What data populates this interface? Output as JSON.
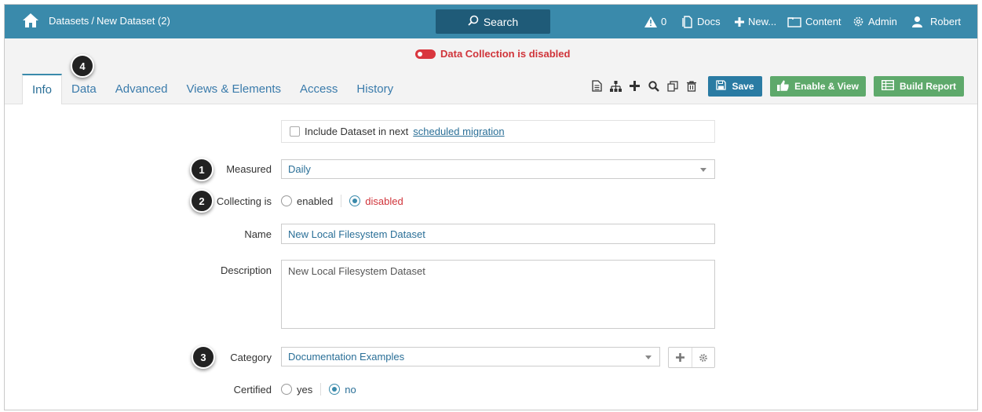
{
  "header": {
    "breadcrumb_root": "Datasets",
    "breadcrumb_sep": "/",
    "breadcrumb_current": "New Dataset (2)",
    "search_label": "Search",
    "alerts_count": "0",
    "docs_label": "Docs",
    "new_label": "New...",
    "content_label": "Content",
    "admin_label": "Admin",
    "user_label": "Robert"
  },
  "status": {
    "data_collection": "Data Collection is disabled",
    "color": "#d0343a"
  },
  "tabs": [
    {
      "label": "Info",
      "active": true
    },
    {
      "label": "Data"
    },
    {
      "label": "Advanced"
    },
    {
      "label": "Views & Elements"
    },
    {
      "label": "Access"
    },
    {
      "label": "History"
    }
  ],
  "toolbar": {
    "icons": [
      "document-icon",
      "hierarchy-icon",
      "plus-icon",
      "search-icon",
      "copy-icon",
      "trash-icon"
    ],
    "save_label": "Save",
    "enable_view_label": "Enable & View",
    "build_report_label": "Build Report"
  },
  "callouts": [
    "1",
    "2",
    "3",
    "4"
  ],
  "form": {
    "migration": {
      "text": "Include Dataset in next",
      "link": "scheduled migration",
      "checked": false
    },
    "measured": {
      "label": "Measured",
      "value": "Daily"
    },
    "collecting": {
      "label": "Collecting is",
      "options": [
        "enabled",
        "disabled"
      ],
      "selected": "disabled"
    },
    "name": {
      "label": "Name",
      "value": "New Local Filesystem Dataset"
    },
    "description": {
      "label": "Description",
      "value": "New Local Filesystem Dataset"
    },
    "category": {
      "label": "Category",
      "value": "Documentation Examples"
    },
    "certified": {
      "label": "Certified",
      "options": [
        "yes",
        "no"
      ],
      "selected": "no"
    }
  },
  "colors": {
    "topbar": "#3a8aab",
    "search": "#1f5b78",
    "save": "#2a7ba3",
    "green": "#5ea96b",
    "link": "#2a6f97",
    "disabled_red": "#d0343a"
  }
}
